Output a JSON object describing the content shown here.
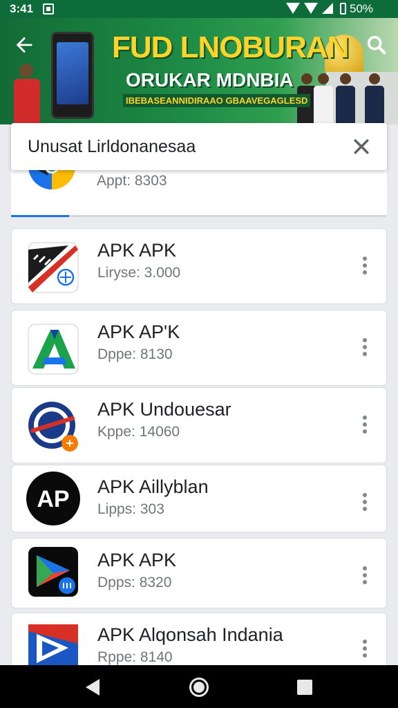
{
  "status_bar": {
    "time": "3:41",
    "battery": "50%",
    "icons": [
      "notification-icon",
      "wifi-icon",
      "wifi-icon",
      "signal-icon",
      "battery-icon"
    ]
  },
  "banner": {
    "title_line1": "FUD LNOBURAN",
    "title_line2": "ORUKAR MDNBIA",
    "title_line3": "IBEBASEANNIDIRAAO GBAAVEGAGLESD",
    "back_icon": "back-arrow-icon",
    "search_icon": "search-icon"
  },
  "search": {
    "query": "Unusat Lirldonanesaa",
    "clear_icon": "close-icon"
  },
  "partial_result": {
    "meta": "Appt: 8303"
  },
  "apps": [
    {
      "name": "APK APK",
      "meta": "Liryse: 3.000",
      "icon": "striped-red-app-icon"
    },
    {
      "name": "APK AP'K",
      "meta": "Dppe: 8130",
      "icon": "green-a-app-icon"
    },
    {
      "name": "APK Undouesar",
      "meta": "Kppe: 14060",
      "icon": "blue-red-circle-app-icon"
    },
    {
      "name": "APK Aillyblan",
      "meta": "Lipps: 303",
      "icon": "black-ap-app-icon"
    },
    {
      "name": "APK APK",
      "meta": "Dpps: 8320",
      "icon": "play-triangle-app-icon"
    },
    {
      "name": "APK Alqonsah Indania",
      "meta": "Rppe: 8140",
      "icon": "blue-red-play-app-icon"
    }
  ],
  "nav": {
    "back_icon": "nav-back-icon",
    "home_icon": "nav-home-icon",
    "recents_icon": "nav-recents-icon"
  },
  "colors": {
    "status_bar": "#0e6b3a",
    "banner_green": "#1d8a45",
    "title_yellow": "#ffd42a",
    "accent_blue": "#1a73e8"
  }
}
